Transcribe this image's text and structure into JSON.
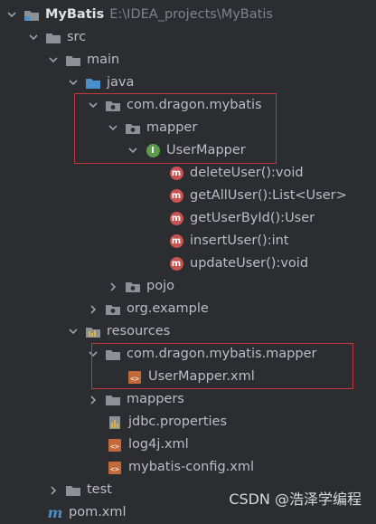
{
  "project": {
    "name": "MyBatis",
    "path": "E:\\IDEA_projects\\MyBatis"
  },
  "nodes": {
    "src": "src",
    "main": "main",
    "java": "java",
    "pkg": "com.dragon.mybatis",
    "mapper": "mapper",
    "user_mapper": "UserMapper",
    "methods": [
      "deleteUser():void",
      "getAllUser():List<User>",
      "getUserById():User",
      "insertUser():int",
      "updateUser():void"
    ],
    "pojo": "pojo",
    "org_example": "org.example",
    "resources": "resources",
    "res_pkg": "com.dragon.mybatis.mapper",
    "user_mapper_xml": "UserMapper.xml",
    "mappers": "mappers",
    "jdbc": "jdbc.properties",
    "log4j": "log4j.xml",
    "mybatis_config": "mybatis-config.xml",
    "test": "test",
    "pom": "pom.xml"
  },
  "icons": {
    "method_letter": "m",
    "interface_letter": "I",
    "maven_letter": "m"
  },
  "watermark": "CSDN @浩泽学编程",
  "colors": {
    "background": "#2b2d30",
    "folder": "#8c9196",
    "source_folder": "#4a8fc9",
    "method_badge": "#c75450",
    "interface_badge": "#5e9a4e",
    "highlight_box": "#c23b3b"
  }
}
